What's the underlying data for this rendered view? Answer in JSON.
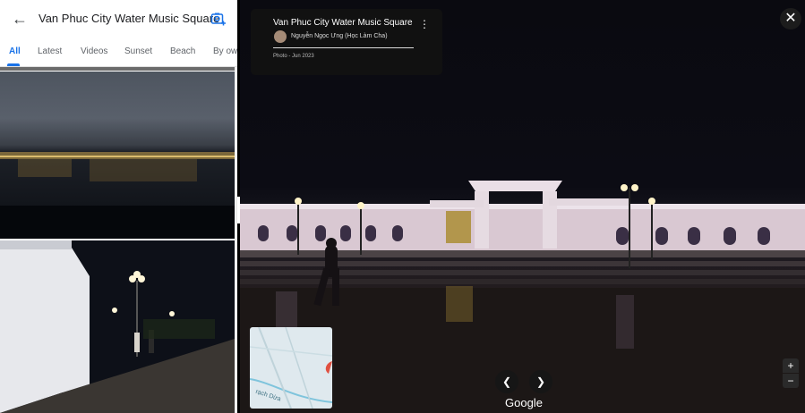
{
  "search": {
    "title": "Van Phuc City Water Music Square"
  },
  "tabs": [
    {
      "label": "All",
      "active": true
    },
    {
      "label": "Latest",
      "active": false
    },
    {
      "label": "Videos",
      "active": false
    },
    {
      "label": "Sunset",
      "active": false
    },
    {
      "label": "Beach",
      "active": false
    },
    {
      "label": "By own",
      "active": false
    }
  ],
  "viewer": {
    "place_title": "Van Phuc City Water Music Square",
    "author": "Nguyễn Ngọc Ưng (Học Làm Cha)",
    "date": "Photo - Jun 2023"
  },
  "minimap": {
    "label": "rạch Dừa"
  },
  "branding": {
    "logo": "Google"
  },
  "colors": {
    "accent": "#1a73e8",
    "panel_bg": "#ffffff",
    "viewer_bg": "#000000"
  },
  "icons": {
    "back": "arrow-left-icon",
    "camera": "add-photo-icon",
    "menu": "more-vert-icon",
    "close": "close-icon",
    "prev": "chevron-left-icon",
    "next": "chevron-right-icon",
    "collapse": "chevron-left-icon"
  }
}
